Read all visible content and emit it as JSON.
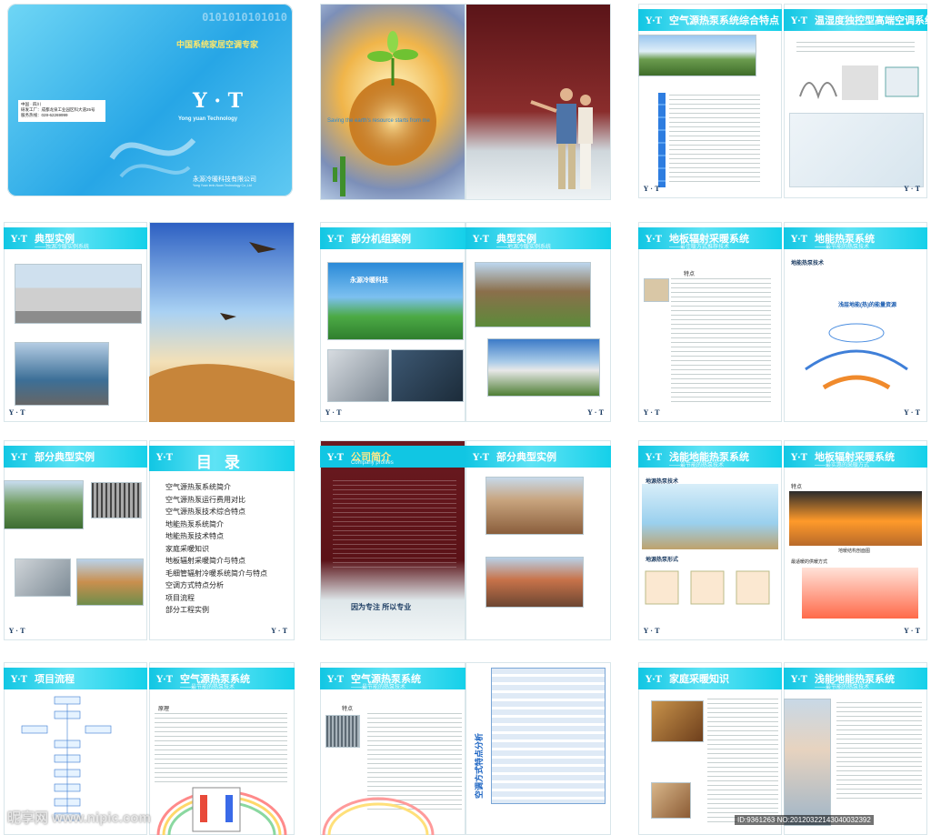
{
  "cover": {
    "slogan": "中国系统家居空调专家",
    "logo": "Y · T",
    "english": "Yong yuan Technology",
    "company_cn": "永源冷暖科技有限公司",
    "company_en": "Yong Yuan lenh-Nuan Technology Co.,Ltd",
    "address": [
      "中国 · 四川",
      "研发工厂：成都龙泉工业园区科大道25号",
      "服务热线：028-62269999"
    ],
    "binary": "0101010101010"
  },
  "spread1": {
    "banner": "Saving the earth's resource starts from me"
  },
  "p_overview": {
    "title": "空气源热泵系统综合特点"
  },
  "p_temp": {
    "title": "温湿度独控型高端空调系统"
  },
  "p_case1": {
    "title": "典型实例",
    "sub": "——独源冷暖实例系统"
  },
  "p_units": {
    "title": "部分机组案例",
    "logo_text": "永源冷暖科技"
  },
  "p_case2": {
    "title": "典型实例",
    "sub": "——地源冷暖实例系统"
  },
  "p_floor1": {
    "title": "地板辐射采暖系统",
    "sub": "——最佳暖方式推荐技术",
    "label": "特点"
  },
  "p_ground1": {
    "title": "地能热泵系统",
    "sub": "——最节能的热泵技术",
    "label": "地能热泵技术",
    "chart": "浅层地能(热)的能量资源"
  },
  "p_partcase": {
    "title": "部分典型实例"
  },
  "p_toc": {
    "title": "目 录",
    "items": [
      "空气源热泵系统简介",
      "空气源热泵运行费用对比",
      "空气源热泵技术综合特点",
      "地能热泵系统简介",
      "地能热泵技术特点",
      "家庭采暖知识",
      "地板辐射采暖简介与特点",
      "毛细管辐射冷暖系统简介与特点",
      "空调方式特点分析",
      "项目流程",
      "部分工程实例"
    ]
  },
  "p_intro": {
    "title": "公司简介",
    "sub": "Company profiles",
    "motto": "因为专注 所以专业"
  },
  "p_partcase2": {
    "title": "部分典型实例"
  },
  "p_ground2": {
    "title": "浅能地能热泵系统",
    "sub": "——最节能的热泵技术",
    "label1": "地源热泵技术",
    "label2": "地源热泵形式"
  },
  "p_floor2": {
    "title": "地板辐射采暖系统",
    "sub": "——最实惠的采暖方式",
    "label1": "特点",
    "label2": "地暖结构剖面图",
    "label3": "最适暖的供暖方式"
  },
  "p_flow": {
    "title": "项目流程"
  },
  "p_air1": {
    "title": "空气源热泵系统",
    "sub": "——最节能的热泵技术",
    "label": "原理"
  },
  "p_air2": {
    "title": "空气源热泵系统",
    "sub": "——最节能的热泵技术",
    "label": "特点"
  },
  "p_compare": {
    "vertical": "空调方式特点分析"
  },
  "p_home": {
    "title": "家庭采暖知识"
  },
  "p_shallow": {
    "title": "浅能地能热泵系统",
    "sub": "——最节能的热泵技术"
  },
  "footer_logo": "Y · T",
  "watermark": {
    "left": "昵享网 www.nipic.com",
    "right": "ID:9361263 NO:20120322143040032392"
  },
  "colors": {
    "accent": "#11c6e3",
    "dark": "#1d3d63",
    "maroon": "#7a1d24"
  }
}
